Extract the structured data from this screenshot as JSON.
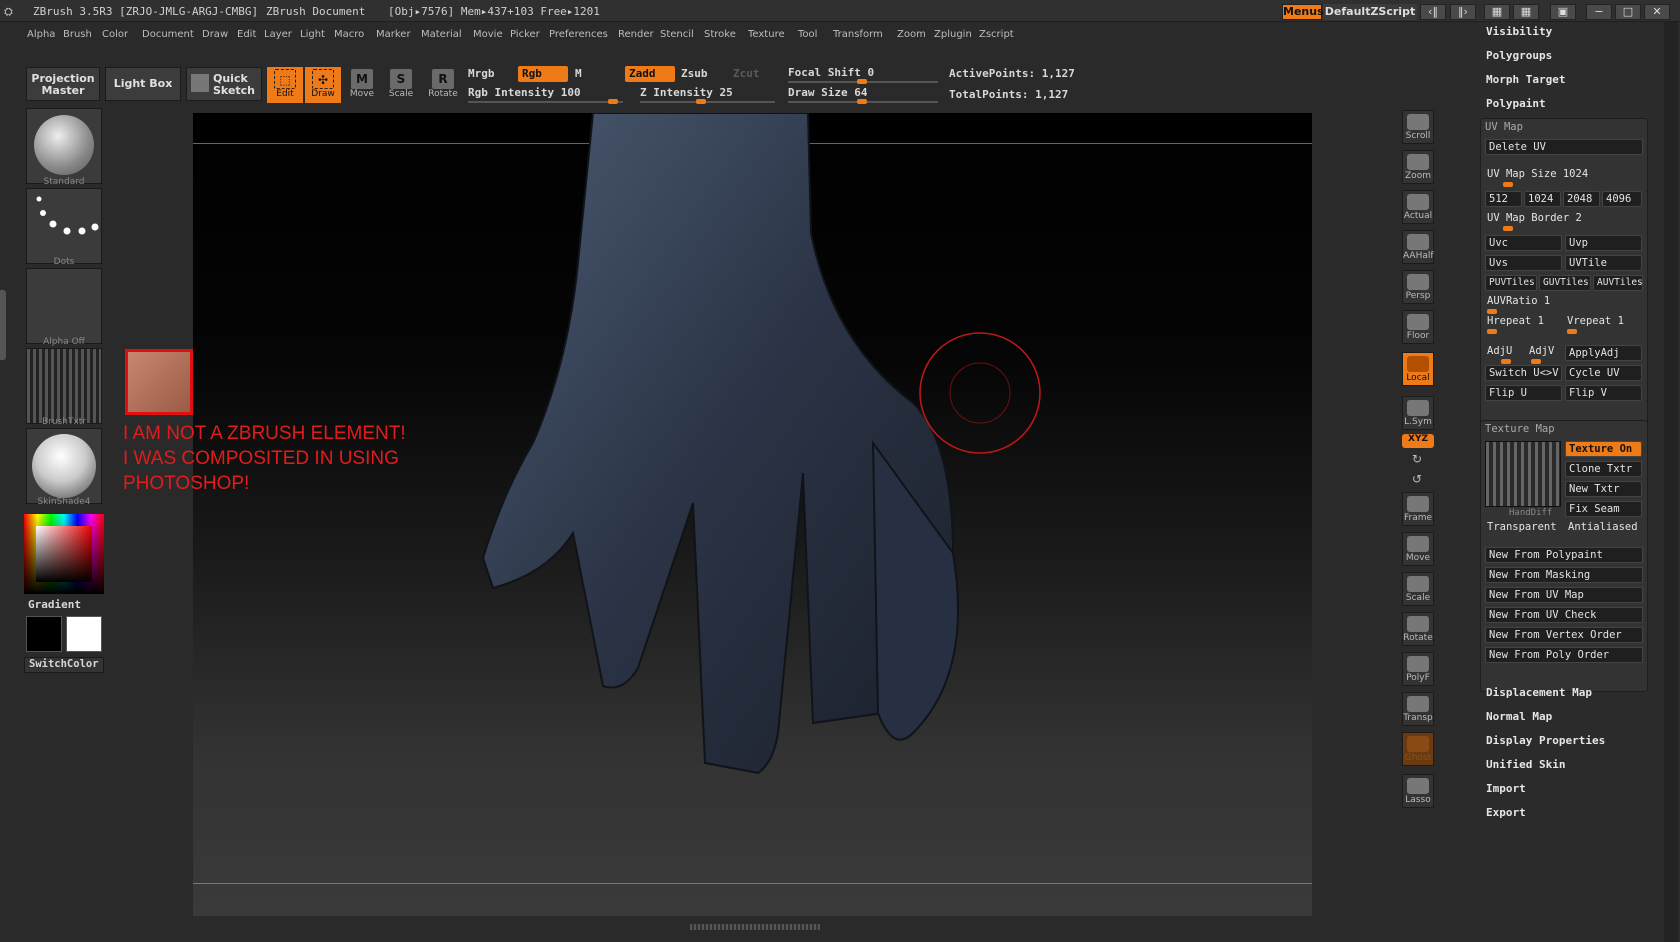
{
  "titlebar": {
    "app": "ZBrush 3.5R3 [ZRJO-JMLG-ARGJ-CMBG]",
    "document": "ZBrush Document",
    "stats": "[Obj▸7576] Mem▸437+103 Free▸1201",
    "menus_label": "Menus",
    "script_label": "DefaultZScript"
  },
  "menubar": [
    "Alpha",
    "Brush",
    "Color",
    "Document",
    "Draw",
    "Edit",
    "Layer",
    "Light",
    "Macro",
    "Marker",
    "Material",
    "Movie",
    "Picker",
    "Preferences",
    "Render",
    "Stencil",
    "Stroke",
    "Texture",
    "Tool",
    "Transform",
    "Zoom",
    "Zplugin",
    "Zscript"
  ],
  "toolbar": {
    "projection_master": "Projection Master",
    "lightbox": "Light Box",
    "quick_sketch": "Quick Sketch",
    "edit": "Edit",
    "draw": "Draw",
    "move": "Move",
    "scale": "Scale",
    "rotate": "Rotate",
    "mrgb": "Mrgb",
    "rgb": "Rgb",
    "m": "M",
    "zadd": "Zadd",
    "zsub": "Zsub",
    "zcut": "Zcut",
    "rgb_intensity": "Rgb Intensity 100",
    "z_intensity": "Z Intensity 25",
    "focal_shift": "Focal Shift 0",
    "draw_size": "Draw Size 64",
    "active_points": "ActivePoints: 1,127",
    "total_points": "TotalPoints: 1,127"
  },
  "leftshelf": {
    "brush": "Standard",
    "stroke": "Dots",
    "alpha": "Alpha Off",
    "texture": "BrushTxtr",
    "material": "SkinShade4",
    "gradient": "Gradient",
    "switch_color": "SwitchColor"
  },
  "overlay": {
    "line1": "I AM NOT A ZBRUSH ELEMENT!",
    "line2": "I WAS COMPOSITED IN USING",
    "line3": "PHOTOSHOP!"
  },
  "rightbar": [
    "Scroll",
    "Zoom",
    "Actual",
    "AAHalf",
    "Persp",
    "Floor",
    "Local",
    "L.Sym",
    "XYZ",
    "Frame",
    "Move",
    "Scale",
    "Rotate",
    "PolyF",
    "Transp",
    "Ghost",
    "Lasso"
  ],
  "rightpanel": {
    "visibility": "Visibility",
    "polygroups": "Polygroups",
    "morph_target": "Morph Target",
    "polypaint": "Polypaint",
    "uvmap": {
      "title": "UV Map",
      "delete_uv": "Delete UV",
      "size_label": "UV Map Size 1024",
      "sizes": [
        "512",
        "1024",
        "2048",
        "4096"
      ],
      "border": "UV Map Border 2",
      "uvc": "Uvc",
      "uvp": "Uvp",
      "uvs": "Uvs",
      "uvtile": "UVTile",
      "puvtiles": "PUVTiles",
      "guvtiles": "GUVTiles",
      "auvtiles": "AUVTiles",
      "auvratio": "AUVRatio 1",
      "hrepeat": "Hrepeat 1",
      "vrepeat": "Vrepeat 1",
      "adju": "AdjU",
      "adjv": "AdjV",
      "applyadj": "ApplyAdj",
      "switch": "Switch U<>V",
      "cycle": "Cycle UV",
      "flipu": "Flip U",
      "flipv": "Flip V"
    },
    "texmap": {
      "title": "Texture Map",
      "texture_on": "Texture On",
      "clone_txtr": "Clone Txtr",
      "new_txtr": "New Txtr",
      "fix_seam": "Fix Seam",
      "thumb_label": "HandDiff",
      "transparent": "Transparent",
      "antialiased": "Antialiased",
      "new_from": [
        "New From Polypaint",
        "New From Masking",
        "New From UV Map",
        "New From UV Check",
        "New From Vertex Order",
        "New From Poly Order"
      ]
    },
    "displacement_map": "Displacement Map",
    "normal_map": "Normal Map",
    "display_properties": "Display Properties",
    "unified_skin": "Unified Skin",
    "import": "Import",
    "export": "Export"
  }
}
